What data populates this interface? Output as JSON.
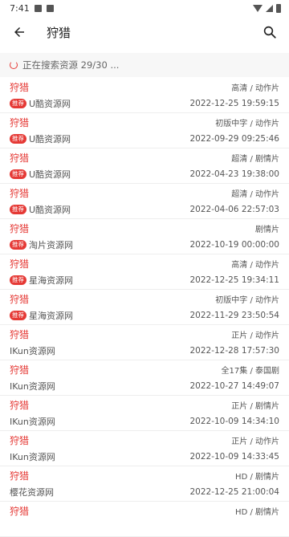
{
  "status_bar": {
    "time": "7:41"
  },
  "app_bar": {
    "title": "狩猎"
  },
  "progress": {
    "text": "正在搜索资源 29/30 ..."
  },
  "results": [
    {
      "name": "狩猎",
      "tags": "高清 / 动作片",
      "recommended": true,
      "badge": "推荐",
      "source": "U酷资源网",
      "time": "2022-12-25 19:59:15"
    },
    {
      "name": "狩猎",
      "tags": "初版中字 / 动作片",
      "recommended": true,
      "badge": "推荐",
      "source": "U酷资源网",
      "time": "2022-09-29 09:25:46"
    },
    {
      "name": "狩猎",
      "tags": "超清 / 剧情片",
      "recommended": true,
      "badge": "推荐",
      "source": "U酷资源网",
      "time": "2022-04-23 19:38:00"
    },
    {
      "name": "狩猎",
      "tags": "超清 / 动作片",
      "recommended": true,
      "badge": "推荐",
      "source": "U酷资源网",
      "time": "2022-04-06 22:57:03"
    },
    {
      "name": "狩猎",
      "tags": "剧情片",
      "recommended": true,
      "badge": "推荐",
      "source": "淘片资源网",
      "time": "2022-10-19 00:00:00"
    },
    {
      "name": "狩猎",
      "tags": "高清 / 动作片",
      "recommended": true,
      "badge": "推荐",
      "source": "星海资源网",
      "time": "2022-12-25 19:34:11"
    },
    {
      "name": "狩猎",
      "tags": "初版中字 / 动作片",
      "recommended": true,
      "badge": "推荐",
      "source": "星海资源网",
      "time": "2022-11-29 23:50:54"
    },
    {
      "name": "狩猎",
      "tags": "正片 / 动作片",
      "recommended": false,
      "badge": "",
      "source": "IKun资源网",
      "time": "2022-12-28 17:57:30"
    },
    {
      "name": "狩猎",
      "tags": "全17集 / 泰国剧",
      "recommended": false,
      "badge": "",
      "source": "IKun资源网",
      "time": "2022-10-27 14:49:07"
    },
    {
      "name": "狩猎",
      "tags": "正片 / 剧情片",
      "recommended": false,
      "badge": "",
      "source": "IKun资源网",
      "time": "2022-10-09 14:34:10"
    },
    {
      "name": "狩猎",
      "tags": "正片 / 动作片",
      "recommended": false,
      "badge": "",
      "source": "IKun资源网",
      "time": "2022-10-09 14:33:45"
    },
    {
      "name": "狩猎",
      "tags": "HD / 剧情片",
      "recommended": false,
      "badge": "",
      "source": "樱花资源网",
      "time": "2022-12-25 21:00:04"
    },
    {
      "name": "狩猎",
      "tags": "HD / 剧情片",
      "recommended": false,
      "badge": "",
      "source": "",
      "time": ""
    }
  ],
  "icons": {
    "back": "arrow-left-icon",
    "search": "search-icon",
    "spinner": "spinner-icon"
  },
  "colors": {
    "accent": "#e53935",
    "text": "#333333",
    "muted": "#555555"
  }
}
